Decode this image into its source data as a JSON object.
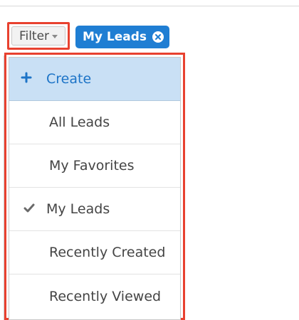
{
  "filter": {
    "label": "Filter"
  },
  "active_filter_pill": {
    "label": "My Leads"
  },
  "dropdown": {
    "create_label": "Create",
    "items": [
      {
        "label": "All Leads",
        "checked": false
      },
      {
        "label": "My Favorites",
        "checked": false
      },
      {
        "label": "My Leads",
        "checked": true
      },
      {
        "label": "Recently Created",
        "checked": false
      },
      {
        "label": "Recently Viewed",
        "checked": false
      }
    ]
  },
  "colors": {
    "highlight_border": "#e8412f",
    "pill_bg": "#1f7ed3",
    "create_bg": "#c9e0f5",
    "create_text": "#1d74c7"
  },
  "icons": {
    "create": "plus-icon",
    "selected": "checkmark-icon",
    "remove_pill": "close-circle-icon",
    "filter_dropdown": "caret-down-icon"
  }
}
